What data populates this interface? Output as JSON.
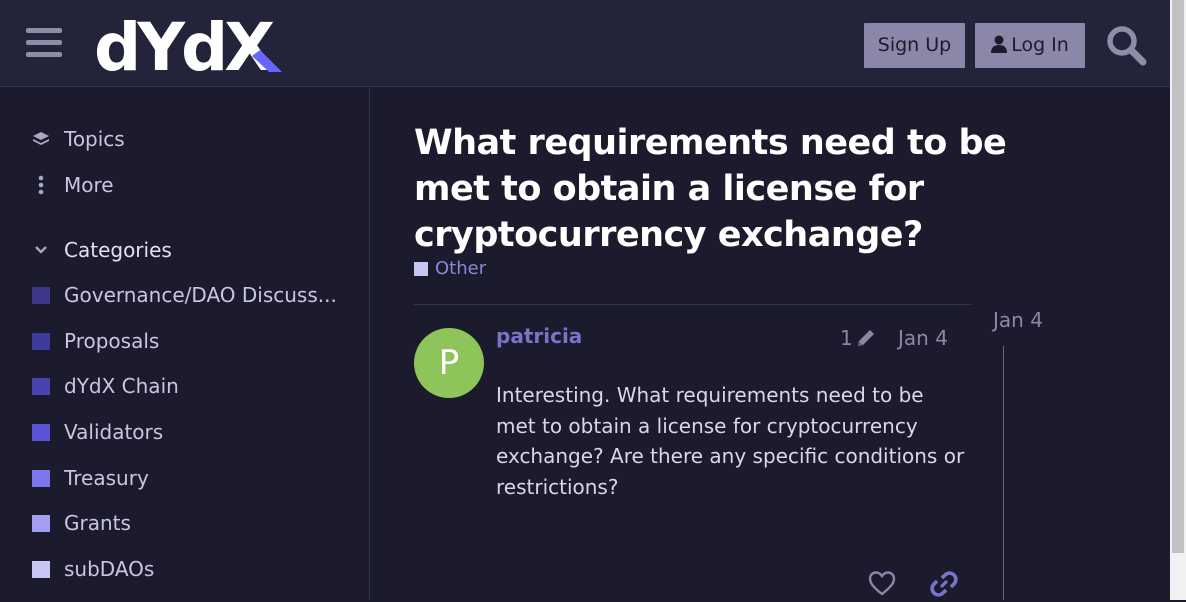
{
  "header": {
    "logo_text": "dYdX",
    "signup_label": "Sign Up",
    "login_label": "Log In"
  },
  "sidebar": {
    "topics_label": "Topics",
    "more_label": "More",
    "categories_label": "Categories",
    "categories": [
      {
        "label": "Governance/DAO Discuss...",
        "color": "#3b3889"
      },
      {
        "label": "Proposals",
        "color": "#3f3b9a"
      },
      {
        "label": "dYdX Chain",
        "color": "#4843b0"
      },
      {
        "label": "Validators",
        "color": "#5a55d6"
      },
      {
        "label": "Treasury",
        "color": "#7c77ec"
      },
      {
        "label": "Grants",
        "color": "#a29ff2"
      },
      {
        "label": "subDAOs",
        "color": "#c9c6f5"
      }
    ]
  },
  "topic": {
    "title": "What requirements need to be met to obtain a license for cryptocurrency exchange?",
    "category": "Other",
    "category_color": "#c9c6f5"
  },
  "post": {
    "avatar_letter": "P",
    "avatar_color": "#8dc55a",
    "username": "patricia",
    "edit_count": "1",
    "date": "Jan 4",
    "body": "Interesting. What requirements need to be met to obtain a license for cryptocurrency exchange? Are there any specific conditions or restrictions?"
  },
  "timeline": {
    "date": "Jan 4"
  },
  "colors": {
    "background": "#1c1b2d",
    "header": "#23233a",
    "accent": "#7a73c9",
    "button": "#8a87a8"
  }
}
